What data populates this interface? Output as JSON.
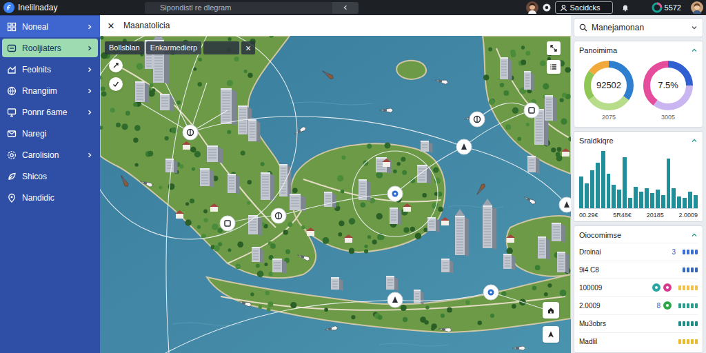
{
  "app": {
    "title": "Inelilnaday"
  },
  "top_search": {
    "placeholder": "Sipondistl re dlegram"
  },
  "account_button": {
    "label": "Sacidcks"
  },
  "user_badge": {
    "label": "5572"
  },
  "sidebar": {
    "items": [
      {
        "label": "Noneal",
        "kind": "group",
        "current": true,
        "selected": false
      },
      {
        "label": "Rooljiaters",
        "kind": "group",
        "current": false,
        "selected": true
      },
      {
        "label": "Feolnits",
        "kind": "group",
        "current": false,
        "selected": false
      },
      {
        "label": "Rnangiim",
        "kind": "group",
        "current": false,
        "selected": false
      },
      {
        "label": "Ponnr 6ame",
        "kind": "group",
        "current": false,
        "selected": false
      },
      {
        "label": "Naregi",
        "kind": "link",
        "current": false,
        "selected": false
      },
      {
        "label": "Carolision",
        "kind": "group",
        "current": false,
        "selected": false
      },
      {
        "label": "Shicos",
        "kind": "link",
        "current": false,
        "selected": false
      },
      {
        "label": "Nandidic",
        "kind": "link",
        "current": false,
        "selected": false
      }
    ]
  },
  "map_panel": {
    "close": "×",
    "title": "Maanatolicia",
    "toolbar": {
      "layer": "Bollsblan",
      "field": "Enkarmedierp",
      "clear": "×"
    }
  },
  "right_panel": {
    "search": {
      "value": "Manejamonan"
    },
    "overview": {
      "title": "Panoimima",
      "donuts": [
        {
          "value": "92502",
          "caption": "2075",
          "segments": [
            {
              "level": 0.35,
              "color": "#2f7fd0"
            },
            {
              "level": 0.3,
              "color": "#b8dd8a"
            },
            {
              "level": 0.2,
              "color": "#8fc754"
            },
            {
              "level": 0.15,
              "color": "#f2a93b"
            }
          ]
        },
        {
          "value": "7.5%",
          "caption": "3005",
          "segments": [
            {
              "level": 0.25,
              "color": "#2f5fd0"
            },
            {
              "level": 0.35,
              "color": "#c9b6f0"
            },
            {
              "level": 0.4,
              "color": "#e64c9c"
            }
          ]
        }
      ]
    },
    "bar_card": {
      "title": "Sraidkiqre",
      "values": [
        38,
        30,
        46,
        55,
        70,
        42,
        28,
        22,
        62,
        12,
        26,
        20,
        24,
        18,
        22,
        16,
        60,
        24,
        14,
        12,
        20,
        16
      ],
      "ticks": [
        "00.29€",
        "5R48€",
        "20185",
        "2.0009"
      ]
    },
    "list_card": {
      "title": "Oiocomimse",
      "rows": [
        {
          "label": "Droinai",
          "value": "3",
          "badges": [],
          "pips": [
            "#3b6fd6",
            "#3b6fd6",
            "#3b6fd6",
            "#3b6fd6"
          ]
        },
        {
          "label": "9i4 C8",
          "badges": [],
          "pips": [
            "#3569b8",
            "#3569b8",
            "#3569b8",
            "#3569b8"
          ]
        },
        {
          "label": "100009",
          "badges": [
            "#2aa7a0",
            "#d9398f"
          ],
          "pips": [
            "#f0c24a",
            "#f0c24a",
            "#f0c24a",
            "#f0c24a",
            "#f0c24a"
          ]
        },
        {
          "label": "2.0009",
          "value": "8",
          "badges": [
            "#2ea84a"
          ],
          "pips": [
            "#2a9d8f",
            "#2a9d8f",
            "#2a9d8f",
            "#2a9d8f",
            "#2a9d8f"
          ]
        },
        {
          "label": "Mu3obrs",
          "badges": [],
          "pips": [
            "#1e8c86",
            "#1e8c86",
            "#1e8c86",
            "#1e8c86",
            "#1e8c86"
          ]
        },
        {
          "label": "Madlil",
          "badges": [],
          "pips": [
            "#e9b92e",
            "#e9b92e",
            "#e9b92e",
            "#e9b92e",
            "#e9b92e"
          ]
        }
      ]
    }
  }
}
